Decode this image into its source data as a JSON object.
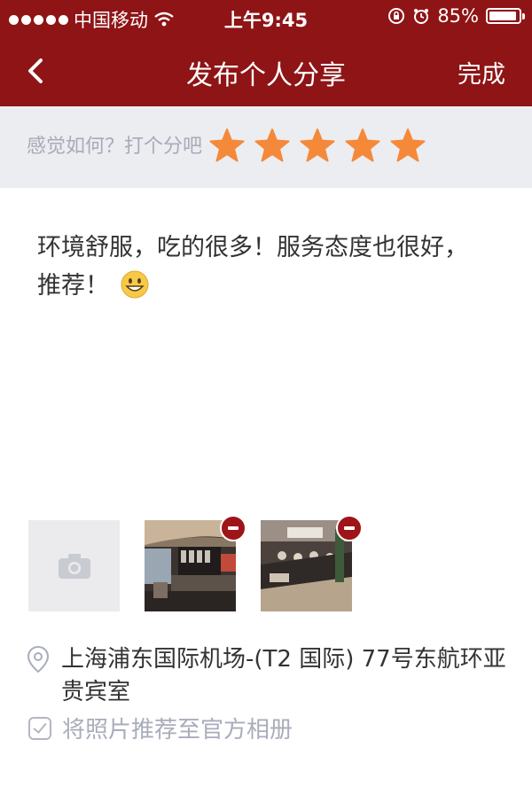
{
  "status_bar": {
    "carrier": "中国移动",
    "time": "上午9:45",
    "battery": "85%"
  },
  "nav": {
    "title": "发布个人分享",
    "done_label": "完成",
    "back_icon": "chevron-left-icon"
  },
  "rating": {
    "prompt": "感觉如何？打个分吧",
    "value": 5,
    "max": 5,
    "star_color": "#f5893a"
  },
  "review": {
    "line1": "环境舒服，吃的很多！服务态度也很好，",
    "line2": "推荐！",
    "emoji": "grinning-face-emoji"
  },
  "photos": {
    "add_icon": "camera-icon",
    "remove_icon": "minus-circle-icon",
    "items": [
      "lounge-bar-photo",
      "lounge-buffet-photo"
    ]
  },
  "location": {
    "line1": "上海浦东国际机场-(T2 国际) 77号东航环亚",
    "line2": "贵宾室"
  },
  "recommend": {
    "label": "将照片推荐至官方相册",
    "checked": false
  },
  "colors": {
    "brand": "#8e1416",
    "rating_bg": "#ecedf0",
    "muted_text": "#a9adbb"
  }
}
